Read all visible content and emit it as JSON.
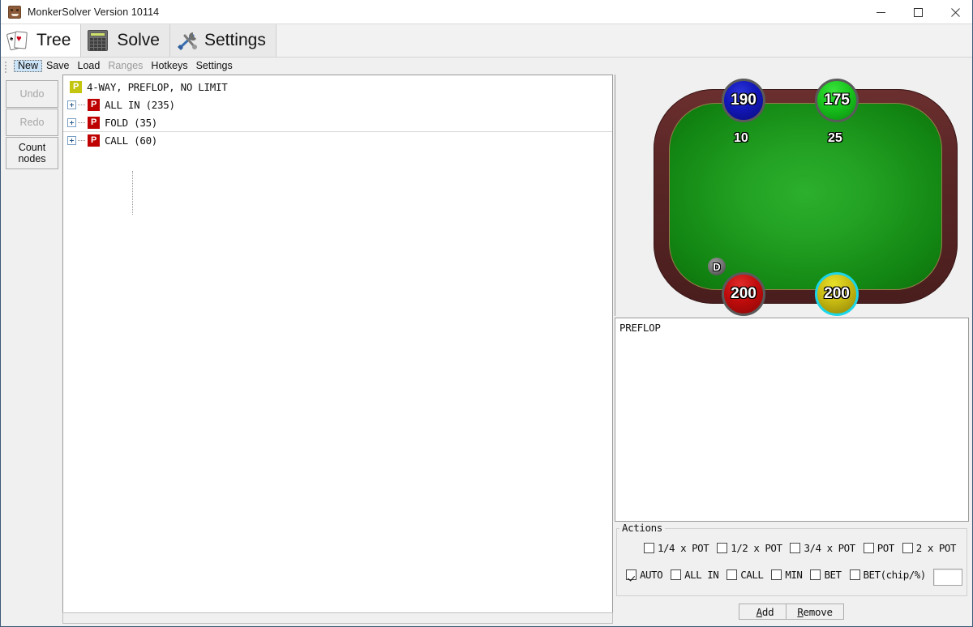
{
  "window": {
    "title": "MonkerSolver Version 10114",
    "icon": "app-icon",
    "minimize_label": "–",
    "maximize_label": "□",
    "close_label": "✕"
  },
  "tabs": [
    {
      "label": "Tree",
      "icon": "playing-cards-icon",
      "active": true
    },
    {
      "label": "Solve",
      "icon": "calculator-icon",
      "active": false
    },
    {
      "label": "Settings",
      "icon": "tools-icon",
      "active": false
    }
  ],
  "menu": [
    {
      "label": "New",
      "state": "focused"
    },
    {
      "label": "Save",
      "state": "normal"
    },
    {
      "label": "Load",
      "state": "normal"
    },
    {
      "label": "Ranges",
      "state": "disabled"
    },
    {
      "label": "Hotkeys",
      "state": "normal"
    },
    {
      "label": "Settings",
      "state": "normal"
    }
  ],
  "side_buttons": [
    {
      "label": "Undo",
      "enabled": false
    },
    {
      "label": "Redo",
      "enabled": false
    },
    {
      "label": "Count nodes",
      "line1": "Count",
      "line2": "nodes",
      "enabled": true
    }
  ],
  "tree": {
    "root": {
      "badge": "P",
      "label": "4-WAY, PREFLOP, NO LIMIT",
      "badge_color": "#c3c50e"
    },
    "children": [
      {
        "badge": "P",
        "label": "ALL IN (235)",
        "badge_color": "#bf0000",
        "expanded": false
      },
      {
        "badge": "P",
        "label": "FOLD (35)",
        "badge_color": "#bf0000",
        "expanded": false
      },
      {
        "badge": "P",
        "label": "CALL (60)",
        "badge_color": "#bf0000",
        "expanded": false
      }
    ]
  },
  "table": {
    "dealer_marker": "D",
    "players": [
      {
        "seat": "top-left",
        "stack": "190",
        "bet": "10",
        "color": "#1217b8",
        "color_name": "blue",
        "active": false
      },
      {
        "seat": "top-right",
        "stack": "175",
        "bet": "25",
        "color": "#18c41c",
        "color_name": "green",
        "active": false
      },
      {
        "seat": "bottom-left",
        "stack": "200",
        "bet": "",
        "color": "#c00c0c",
        "color_name": "red",
        "active": false
      },
      {
        "seat": "bottom-right",
        "stack": "200",
        "bet": "",
        "color": "#c9bb12",
        "color_name": "yellow",
        "active": true
      }
    ]
  },
  "street_box": {
    "text": "PREFLOP"
  },
  "actions": {
    "legend": "Actions",
    "row1": [
      {
        "label": "1/4 x POT",
        "checked": false
      },
      {
        "label": "1/2 x POT",
        "checked": false
      },
      {
        "label": "3/4 x POT",
        "checked": false
      },
      {
        "label": "POT",
        "checked": false
      },
      {
        "label": "2 x POT",
        "checked": false
      }
    ],
    "row2": [
      {
        "label": "AUTO",
        "checked": true
      },
      {
        "label": "ALL IN",
        "checked": false
      },
      {
        "label": "CALL",
        "checked": false
      },
      {
        "label": "MIN",
        "checked": false
      },
      {
        "label": "BET",
        "checked": false
      },
      {
        "label": "BET(chip/%)",
        "checked": false
      }
    ],
    "bet_input_value": "",
    "bet_input_placeholder": ""
  },
  "buttons": {
    "add": {
      "mnemonic": "A",
      "rest": "dd"
    },
    "remove": {
      "mnemonic": "R",
      "rest": "emove"
    }
  },
  "colors": {
    "felt_green": "#18a018",
    "table_rail": "#5b2626",
    "accent_blue": "#0a0b7a",
    "tree_red": "#bf0000",
    "tree_root_olive": "#c3c50e"
  }
}
